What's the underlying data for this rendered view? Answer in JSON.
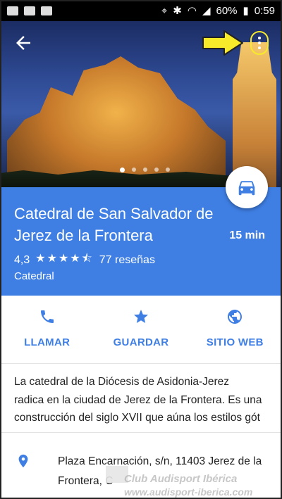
{
  "status_bar": {
    "battery": "60%",
    "time": "0:59"
  },
  "place": {
    "name": "Catedral de San Salvador de Jerez de la Frontera",
    "drive_time": "15 min",
    "rating": "4,3",
    "stars": 4.3,
    "reviews": "77 reseñas",
    "category": "Catedral"
  },
  "photo_pager": {
    "count": 5,
    "active_index": 0
  },
  "actions": [
    {
      "label": "LLAMAR",
      "icon": "phone-icon"
    },
    {
      "label": "GUARDAR",
      "icon": "star-icon"
    },
    {
      "label": "SITIO WEB",
      "icon": "globe-icon"
    }
  ],
  "description": [
    "La catedral de la Diócesis de Asidonia-Jerez",
    "radica en la ciudad de Jerez de la Frontera. Es una",
    "construcción del siglo XVII que aúna los estilos gót"
  ],
  "address": {
    "line1": "Plaza Encarnación, s/n, 11403 Jerez de la",
    "line2": "Frontera, C"
  },
  "watermark": {
    "line1": "Club Audisport Ibérica",
    "line2": "www.audisport-iberica.com"
  },
  "colors": {
    "accent_blue": "#3f7fe4",
    "highlight_yellow": "#f6ea2a"
  }
}
